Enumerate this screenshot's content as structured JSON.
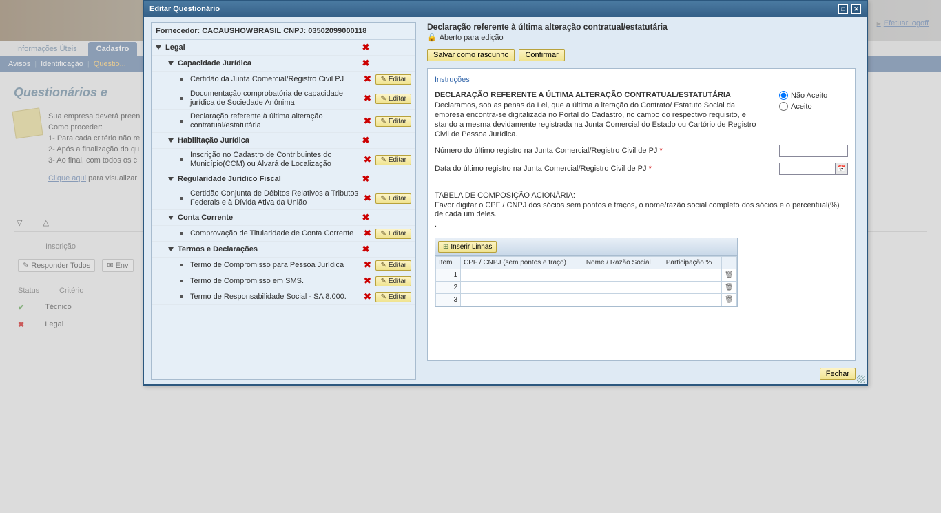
{
  "header": {
    "tabs": [
      "Informações Úteis",
      "Cadastro"
    ],
    "active_tab": 1,
    "subnav": [
      "Avisos",
      "Identificação",
      "Questio..."
    ],
    "logoff": "Efetuar logoff"
  },
  "page": {
    "title": "Questionários e",
    "intro_lines": [
      "Sua empresa deverá preen",
      "Como proceder:",
      "1- Para cada critério não re",
      "2- Após a finalização do qu",
      "3- Ao final, com todos os c"
    ],
    "click_here_pre": "Clique aqui",
    "click_here_post": " para visualizar",
    "resp_todos": "Responder Todos",
    "env": "Env",
    "col_status": "Status",
    "col_criterio": "Critério",
    "col_inscricao": "Inscrição",
    "rows": [
      {
        "status": "ok",
        "label": "Técnico"
      },
      {
        "status": "x",
        "label": "Legal"
      }
    ]
  },
  "dialog": {
    "title": "Editar Questionário",
    "supplier_label": "Fornecedor:",
    "supplier_name": "CACAUSHOWBRASIL",
    "cnpj_label": "CNPJ:",
    "cnpj": "03502099000118",
    "edit_label": "Editar",
    "tree": [
      {
        "level": 1,
        "label": "Legal",
        "hasEdit": false
      },
      {
        "level": 2,
        "label": "Capacidade Jurídica",
        "hasEdit": false
      },
      {
        "level": 3,
        "label": "Certidão da Junta Comercial/Registro Civil PJ",
        "hasEdit": true
      },
      {
        "level": 3,
        "label": "Documentação comprobatória de capacidade jurídica de Sociedade Anônima",
        "hasEdit": true
      },
      {
        "level": 3,
        "label": "Declaração referente à última alteração contratual/estatutária",
        "hasEdit": true
      },
      {
        "level": 2,
        "label": "Habilitação Jurídica",
        "hasEdit": false
      },
      {
        "level": 3,
        "label": "Inscrição no Cadastro de Contribuintes do Município(CCM) ou Alvará de Localização",
        "hasEdit": true
      },
      {
        "level": 2,
        "label": "Regularidade Jurídico Fiscal",
        "hasEdit": false
      },
      {
        "level": 3,
        "label": "Certidão Conjunta de Débitos Relativos a Tributos Federais e à Dívida Ativa da União",
        "hasEdit": true
      },
      {
        "level": 2,
        "label": "Conta Corrente",
        "hasEdit": false
      },
      {
        "level": 3,
        "label": "Comprovação de Titularidade de Conta Corrente",
        "hasEdit": true
      },
      {
        "level": 2,
        "label": "Termos e Declarações",
        "hasEdit": false
      },
      {
        "level": 3,
        "label": "Termo de Compromisso para Pessoa Jurídica",
        "hasEdit": true
      },
      {
        "level": 3,
        "label": "Termo de Compromisso em SMS.",
        "hasEdit": true
      },
      {
        "level": 3,
        "label": "Termo de Responsabilidade Social - SA 8.000.",
        "hasEdit": true
      }
    ]
  },
  "right": {
    "title": "Declaração referente à última alteração contratual/estatutária",
    "open_edit": "Aberto para edição",
    "save_draft": "Salvar como rascunho",
    "confirm": "Confirmar",
    "instructions_link": "Instruções",
    "decl_title": "DECLARAÇÃO REFERENTE A ÚLTIMA ALTERAÇÃO CONTRATUAL/ESTATUTÁRIA",
    "decl_body": "Declaramos, sob as penas da Lei, que a última a lteração do Contrato/ Estatuto Social da empresa encontra-se digitalizada no Portal do Cadastro, no campo do respectivo requisito, e stando a mesma devidamente registrada na Junta Comercial do Estado ou Cartório de Registro Civil de Pessoa Jurídica.",
    "radio_nao": "Não Aceito",
    "radio_sim": "Aceito",
    "field1": "Número do último registro na Junta Comercial/Registro Civil de PJ",
    "field2": "Data do último registro na Junta Comercial/Registro Civil de PJ",
    "table_title": "TABELA DE COMPOSIÇÃO ACIONÁRIA:",
    "table_instr": "Favor digitar o CPF / CNPJ dos sócios sem pontos e traços, o nome/razão social completo dos sócios e o percentual(%) de cada um deles.",
    "insert_rows": "Inserir Linhas",
    "grid_cols": [
      "Item",
      "CPF / CNPJ (sem pontos e traço)",
      "Nome / Razão Social",
      "Participação %",
      ""
    ],
    "grid_rows": [
      1,
      2,
      3
    ],
    "close": "Fechar"
  }
}
